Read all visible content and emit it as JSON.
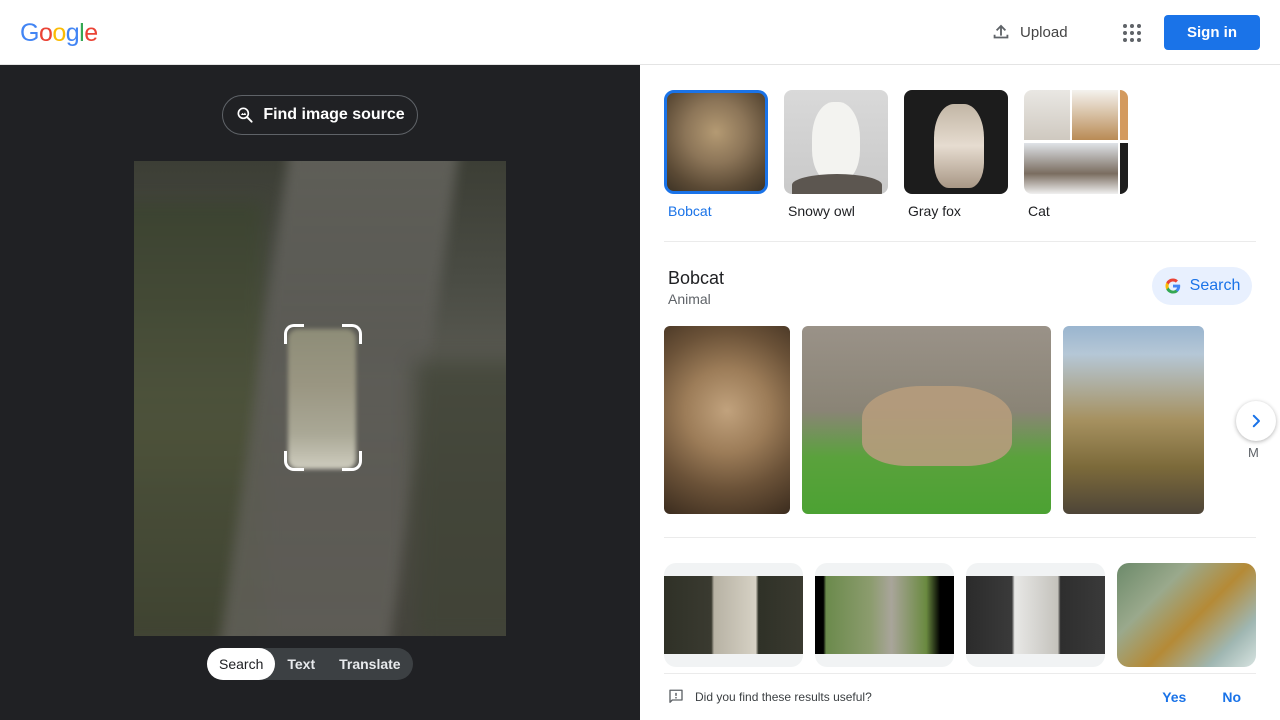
{
  "header": {
    "logo_letters": [
      {
        "char": "G",
        "color": "#4285f4"
      },
      {
        "char": "o",
        "color": "#ea4335"
      },
      {
        "char": "o",
        "color": "#fbbc05"
      },
      {
        "char": "g",
        "color": "#4285f4"
      },
      {
        "char": "l",
        "color": "#34a853"
      },
      {
        "char": "e",
        "color": "#ea4335"
      }
    ],
    "upload_label": "Upload",
    "upload_icon": "upload-icon",
    "apps_icon": "apps-grid-icon",
    "signin_label": "Sign in",
    "accent_color": "#1a73e8"
  },
  "left_panel": {
    "find_source_label": "Find image source",
    "find_source_icon": "image-search-icon",
    "mode_tabs": [
      {
        "label": "Search",
        "active": true
      },
      {
        "label": "Text",
        "active": false
      },
      {
        "label": "Translate",
        "active": false
      }
    ]
  },
  "right_panel": {
    "related_chips": [
      {
        "label": "Bobcat",
        "selected": true
      },
      {
        "label": "Snowy owl",
        "selected": false
      },
      {
        "label": "Gray fox",
        "selected": false
      },
      {
        "label": "Cat",
        "selected": false
      }
    ],
    "entity": {
      "title": "Bobcat",
      "subtitle": "Animal",
      "search_label": "Search",
      "search_icon": "google-g-icon"
    },
    "gallery_more_label": "M",
    "next_icon": "chevron-right-icon",
    "feedback": {
      "question": "Did you find these results useful?",
      "yes_label": "Yes",
      "no_label": "No",
      "icon": "feedback-icon"
    }
  }
}
